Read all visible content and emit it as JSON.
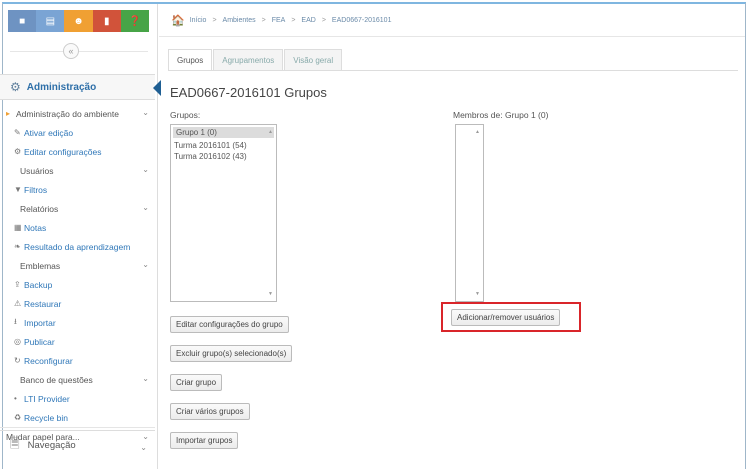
{
  "sidebar": {
    "toolbar_icons": [
      "home-icon",
      "calendar-icon",
      "people-icon",
      "bookmark-icon",
      "help-icon"
    ],
    "admin_title": "Administração",
    "items": [
      {
        "label": "Administração do ambiente",
        "level": "top",
        "chevron": true
      },
      {
        "label": "Ativar edição",
        "icon": "pencil-icon",
        "level": "l1"
      },
      {
        "label": "Editar configurações",
        "icon": "gear-icon",
        "level": "l1"
      },
      {
        "label": "Usuários",
        "level": "l2",
        "chevron": true
      },
      {
        "label": "Filtros",
        "icon": "filter-icon",
        "level": "l1"
      },
      {
        "label": "Relatórios",
        "level": "l2",
        "chevron": true
      },
      {
        "label": "Notas",
        "icon": "grid-icon",
        "level": "l1"
      },
      {
        "label": "Resultado da aprendizagem",
        "icon": "leaf-icon",
        "level": "l1"
      },
      {
        "label": "Emblemas",
        "level": "l2",
        "chevron": true
      },
      {
        "label": "Backup",
        "icon": "upload-icon",
        "level": "l1"
      },
      {
        "label": "Restaurar",
        "icon": "warning-icon",
        "level": "l1"
      },
      {
        "label": "Importar",
        "icon": "import-icon",
        "level": "l1"
      },
      {
        "label": "Publicar",
        "icon": "globe-icon",
        "level": "l1"
      },
      {
        "label": "Reconfigurar",
        "icon": "refresh-icon",
        "level": "l1"
      },
      {
        "label": "Banco de questões",
        "level": "l2",
        "chevron": true
      },
      {
        "label": "LTI Provider",
        "icon": "dot-icon",
        "level": "l1"
      },
      {
        "label": "Recycle bin",
        "icon": "recycle-icon",
        "level": "l1"
      },
      {
        "label": "Mudar papel para...",
        "level": "top",
        "chevron": true,
        "sep": true
      }
    ],
    "nav_label": "Navegação"
  },
  "breadcrumb": [
    "Início",
    "Ambientes",
    "FEA",
    "EAD",
    "EAD0667-2016101"
  ],
  "tabs": [
    {
      "label": "Grupos",
      "active": true
    },
    {
      "label": "Agrupamentos",
      "active": false
    },
    {
      "label": "Visão geral",
      "active": false
    }
  ],
  "page": {
    "title": "EAD0667-2016101 Grupos",
    "groups_label": "Grupos:",
    "members_label": "Membros de: Grupo 1 (0)",
    "groups": [
      "Grupo 1 (0)",
      "Turma 2016101 (54)",
      "Turma 2016102 (43)"
    ],
    "selected_group": "Grupo 1 (0)"
  },
  "buttons": {
    "edit_group": "Editar configurações do grupo",
    "delete_groups": "Excluir grupo(s) selecionado(s)",
    "create_group": "Criar grupo",
    "create_many": "Criar vários grupos",
    "import_groups": "Importar grupos",
    "add_remove_users": "Adicionar/remover usuários"
  },
  "colors": {
    "highlight": "#d9252a",
    "link": "#2f77b8"
  }
}
